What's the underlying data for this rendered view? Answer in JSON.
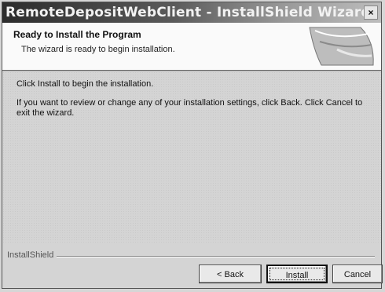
{
  "window": {
    "title": "RemoteDepositWebClient - InstallShield Wizard",
    "close_label": "×"
  },
  "header": {
    "title": "Ready to Install the Program",
    "subtitle": "The wizard is ready to begin installation."
  },
  "content": {
    "line1": "Click Install to begin the installation.",
    "line2": "If you want to review or change any of your installation settings, click Back. Click Cancel to exit the wizard."
  },
  "footer": {
    "brand": "InstallShield",
    "back_label": "< Back",
    "install_label": "Install",
    "cancel_label": "Cancel"
  }
}
